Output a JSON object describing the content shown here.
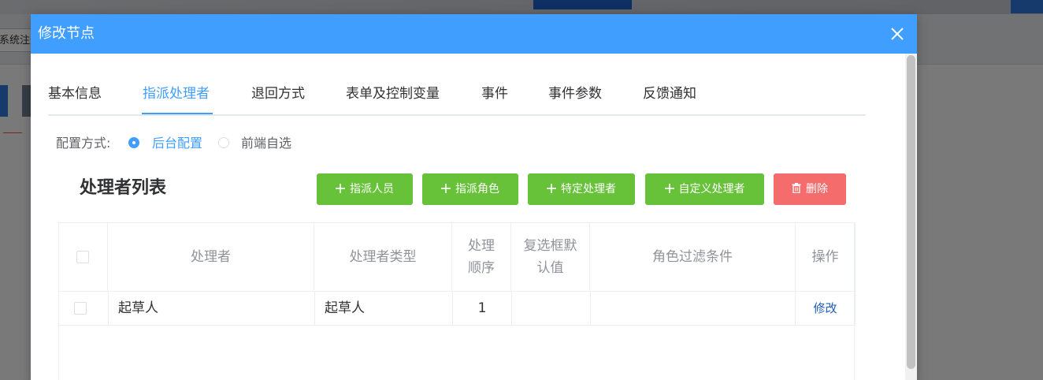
{
  "background": {
    "tab_label": "系统注册"
  },
  "modal": {
    "title": "修改节点",
    "tabs": [
      {
        "label": "基本信息"
      },
      {
        "label": "指派处理者"
      },
      {
        "label": "退回方式"
      },
      {
        "label": "表单及控制变量"
      },
      {
        "label": "事件"
      },
      {
        "label": "事件参数"
      },
      {
        "label": "反馈通知"
      }
    ],
    "active_tab_index": 1,
    "config": {
      "label": "配置方式:",
      "options": [
        {
          "label": "后台配置",
          "checked": true
        },
        {
          "label": "前端自选",
          "checked": false
        }
      ]
    },
    "list_title": "处理者列表",
    "buttons": {
      "assign_person": "指派人员",
      "assign_role": "指派角色",
      "specific_handler": "特定处理者",
      "custom_handler": "自定义处理者",
      "delete": "删除"
    },
    "table": {
      "headers": {
        "handler": "处理者",
        "handler_type": "处理者类型",
        "order": "处理顺序",
        "checkbox_default": "复选框默认值",
        "role_filter": "角色过滤条件",
        "operation": "操作"
      },
      "rows": [
        {
          "handler": "起草人",
          "handler_type": "起草人",
          "order": "1",
          "checkbox_default": "",
          "role_filter": "",
          "operation": "修改"
        }
      ]
    }
  },
  "colors": {
    "primary": "#409eff",
    "success": "#67c23a",
    "danger": "#f56c6c",
    "link": "#1d5cb8"
  }
}
